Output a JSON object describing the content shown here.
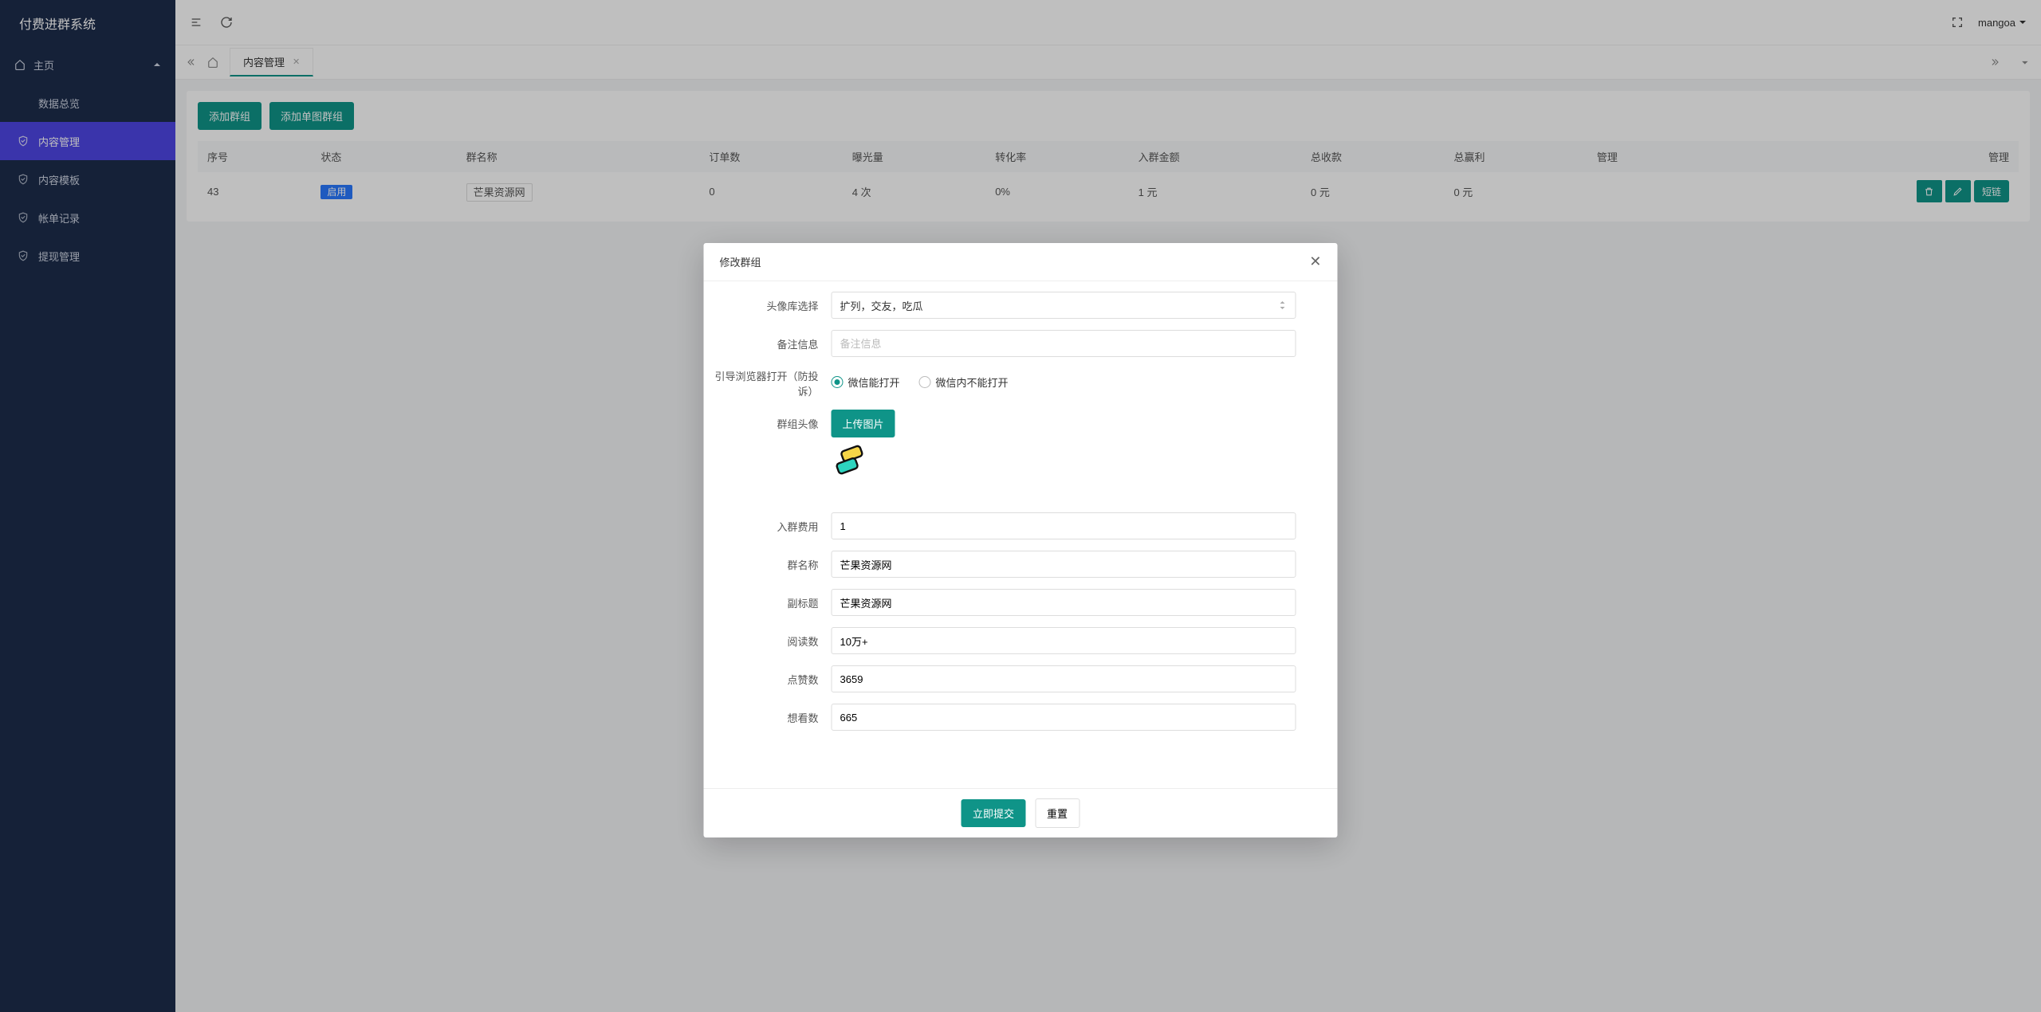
{
  "brand": "付费进群系统",
  "header": {
    "username": "mangoa"
  },
  "sidebar": {
    "root": "主页",
    "items": [
      {
        "label": "数据总览"
      },
      {
        "label": "内容管理"
      },
      {
        "label": "内容模板"
      },
      {
        "label": "帐单记录"
      },
      {
        "label": "提现管理"
      }
    ]
  },
  "tab": {
    "label": "内容管理"
  },
  "toolbar": {
    "add_group": "添加群组",
    "add_single": "添加单图群组"
  },
  "table": {
    "headers": {
      "seq": "序号",
      "status": "状态",
      "name": "群名称",
      "orders": "订单数",
      "exposure": "曝光量",
      "conv": "转化率",
      "amount": "入群金额",
      "total_collect": "总收款",
      "total_profit": "总赢利",
      "manage1": "管理",
      "manage2": "管理"
    },
    "row": {
      "seq": "43",
      "status": "启用",
      "name": "芒果资源网",
      "orders": "0",
      "exposure": "4 次",
      "conv": "0%",
      "amount": "1 元",
      "total_collect": "0 元",
      "total_profit": "0 元",
      "link_btn": "短链"
    }
  },
  "modal": {
    "title": "修改群组",
    "labels": {
      "avatar_lib": "头像库选择",
      "remark": "备注信息",
      "browser_guide": "引导浏览器打开（防投诉）",
      "group_avatar": "群组头像",
      "join_fee": "入群费用",
      "group_name": "群名称",
      "subtitle": "副标题",
      "reads": "阅读数",
      "likes": "点赞数",
      "wants": "想看数"
    },
    "values": {
      "avatar_lib": "扩列，交友，吃瓜",
      "remark_ph": "备注信息",
      "radio_a": "微信能打开",
      "radio_b": "微信内不能打开",
      "upload_btn": "上传图片",
      "join_fee": "1",
      "group_name": "芒果资源网",
      "subtitle": "芒果资源网",
      "reads": "10万+",
      "likes": "3659",
      "wants": "665"
    },
    "footer": {
      "submit": "立即提交",
      "reset": "重置"
    }
  }
}
